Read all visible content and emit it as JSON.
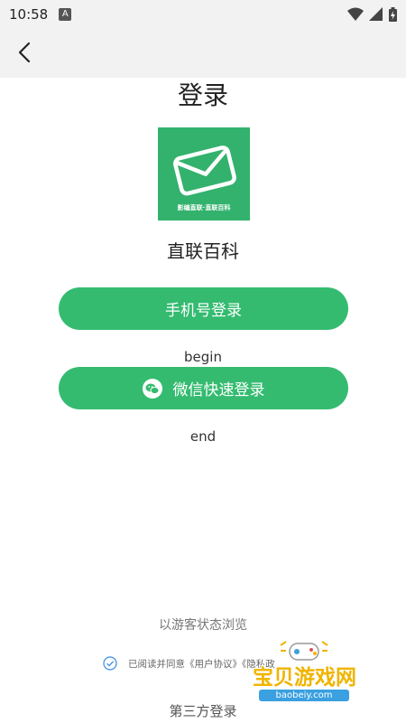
{
  "status_bar": {
    "time": "10:58",
    "notification_icon": "A"
  },
  "header": {
    "title": "登录"
  },
  "logo": {
    "caption": "影编直联·直联百科"
  },
  "app_name": "直联百科",
  "buttons": {
    "phone_login": "手机号登录",
    "wechat_login": "微信快速登录"
  },
  "markers": {
    "begin": "begin",
    "end": "end"
  },
  "guest_link": "以游客状态浏览",
  "agreement": {
    "checked": true,
    "text": "已阅读并同意《用户协议》《隐私政"
  },
  "third_party_label": "第三方登录",
  "watermark": {
    "title": "宝贝游戏网",
    "url": "baobeiy.com"
  },
  "colors": {
    "primary": "#34bb70",
    "logo_bg": "#33b26d",
    "watermark": "#f0b400"
  },
  "icons": [
    "back-arrow-icon",
    "wifi-icon",
    "cellular-icon",
    "battery-icon",
    "wechat-icon",
    "check-circle-icon",
    "envelope-icon",
    "gamepad-icon"
  ]
}
